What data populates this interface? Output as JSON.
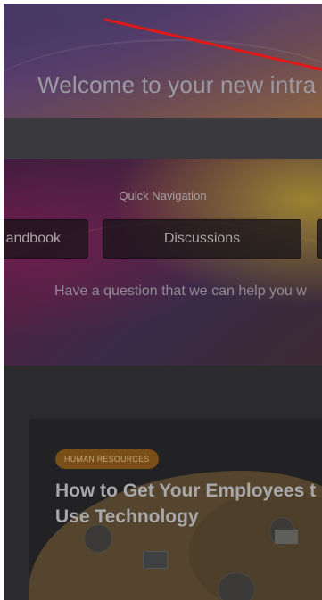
{
  "hero": {
    "title": "Welcome to your new intra"
  },
  "quick_nav": {
    "heading": "Quick Navigation",
    "buttons": [
      {
        "label": "andbook"
      },
      {
        "label": "Discussions"
      },
      {
        "label": ""
      }
    ],
    "question": "Have a question that we can help you w"
  },
  "news_card": {
    "category": "HUMAN RESOURCES",
    "title_line1": "How to Get Your Employees t",
    "title_line2": "Use Technology"
  },
  "annotation": {
    "color": "#e01818"
  }
}
